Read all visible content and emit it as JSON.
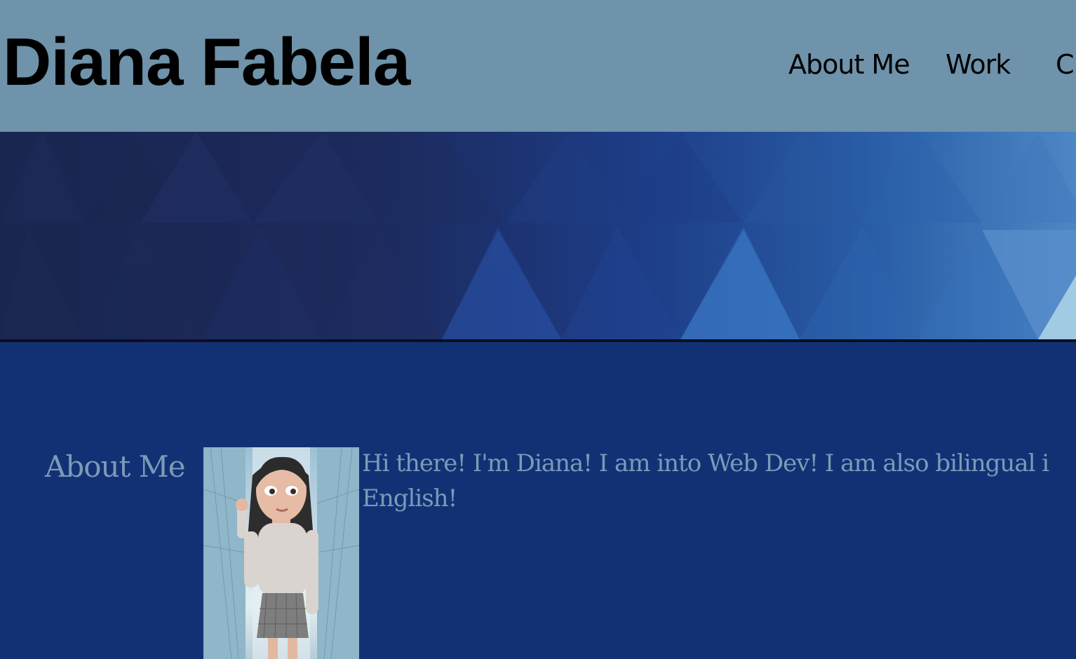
{
  "header": {
    "site_title": "Diana Fabela",
    "nav": [
      {
        "label": "About Me"
      },
      {
        "label": "Work"
      },
      {
        "label": "C"
      }
    ]
  },
  "about": {
    "heading": "About Me",
    "avatar_icon": "avatar-illustration",
    "text": "Hi there! I'm Diana! I am into Web Dev! I am also bilingual i English!"
  },
  "colors": {
    "header_bg": "#6e93aa",
    "main_bg": "#123175",
    "text_muted": "#7c9ab8"
  }
}
